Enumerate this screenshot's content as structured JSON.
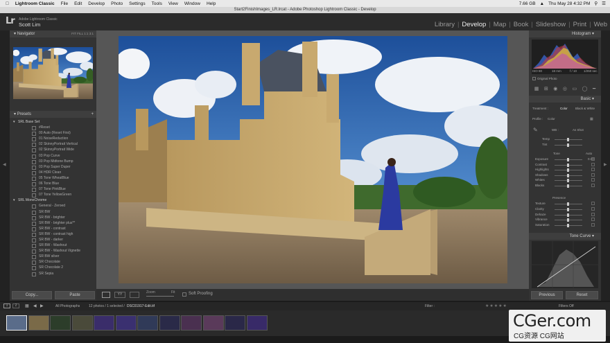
{
  "menubar": {
    "items": [
      "Lightroom Classic",
      "File",
      "Edit",
      "Develop",
      "Photo",
      "Settings",
      "Tools",
      "View",
      "Window",
      "Help"
    ],
    "battery": "7.66 GB",
    "datetime": "Thu May 28  4:32 PM"
  },
  "window": {
    "title": "Start2FinishImages_LR.lrcat - Adobe Photoshop Lightroom Classic - Develop"
  },
  "identity": {
    "logo": "Lr",
    "catalog": "Adobe Lightroom Classic",
    "user": "Scott Lim"
  },
  "modules": [
    "Library",
    "Develop",
    "Map",
    "Book",
    "Slideshow",
    "Print",
    "Web"
  ],
  "navigator": {
    "title": "Navigator",
    "zoom": [
      "FIT",
      "FILL",
      "1:1",
      "3:1"
    ]
  },
  "presets": {
    "title": "Presets",
    "rows": [
      {
        "type": "grp",
        "label": "SRL Base Set"
      },
      {
        "type": "it",
        "label": "#Reset"
      },
      {
        "type": "it",
        "label": "00 Auto (Reset First)"
      },
      {
        "type": "it",
        "label": "01 NoiseReduction"
      },
      {
        "type": "it",
        "label": "02 SkinnyPortrait Vertical"
      },
      {
        "type": "it",
        "label": "02 SkinnyPortrait Wide"
      },
      {
        "type": "it",
        "label": "03 Pop Curve"
      },
      {
        "type": "it",
        "label": "03 Pop Midtone Bump"
      },
      {
        "type": "it",
        "label": "03 Pop Super Duper"
      },
      {
        "type": "it",
        "label": "04 HDR Clean"
      },
      {
        "type": "it",
        "label": "05 Tone WheatBlue"
      },
      {
        "type": "it",
        "label": "06 Tone Blue"
      },
      {
        "type": "it",
        "label": "07 Tone PinkBlue"
      },
      {
        "type": "it",
        "label": "07 Tone YellowGreen"
      },
      {
        "type": "grp",
        "label": "SRL MonoChrome"
      },
      {
        "type": "it",
        "label": "General - Zeroed"
      },
      {
        "type": "it",
        "label": "SR BW"
      },
      {
        "type": "it",
        "label": "SR BW - brighter"
      },
      {
        "type": "it",
        "label": "SR BW - brighter plus**"
      },
      {
        "type": "it",
        "label": "SR BW - contrast"
      },
      {
        "type": "it",
        "label": "SR BW - contrast high"
      },
      {
        "type": "it",
        "label": "SR BW - darker"
      },
      {
        "type": "it",
        "label": "SR BW - Washout"
      },
      {
        "type": "it",
        "label": "SR BW - Washout Vignette"
      },
      {
        "type": "it",
        "label": "SR BW silver"
      },
      {
        "type": "it",
        "label": "SR Chocolate"
      },
      {
        "type": "it",
        "label": "SR Chocolate 2"
      },
      {
        "type": "it",
        "label": "SR Sepia"
      }
    ]
  },
  "leftbuttons": {
    "copy": "Copy...",
    "paste": "Paste"
  },
  "toolbar": {
    "zoom_label": "Zoom",
    "zoom_value": "Fit",
    "soft_proofing": "Soft Proofing"
  },
  "right": {
    "histogram_title": "Histogram",
    "exif": [
      "ISO 80",
      "18 mm",
      "f / 10",
      "1/250 sec"
    ],
    "original_photo": "Original Photo",
    "basic_title": "Basic",
    "treatment": "Treatment :",
    "color": "Color",
    "bw": "Black & White",
    "profile": "Profile :",
    "profile_val": "Color",
    "wb": "WB :",
    "wb_val": "As Shot",
    "temp": "Temp",
    "tint": "Tint",
    "tone": "Tone",
    "auto": "Auto",
    "sliders": [
      "Exposure",
      "Contrast",
      "Highlights",
      "Shadows",
      "Whites",
      "Blacks"
    ],
    "exposure_val": "0.00",
    "presence": "Presence",
    "presence_sliders": [
      "Texture",
      "Clarity",
      "Dehaze",
      "Vibrance",
      "Saturation"
    ],
    "tonecurve_title": "Tone Curve",
    "previous": "Previous",
    "reset": "Reset"
  },
  "filmstrip": {
    "pages": [
      "1",
      "2"
    ],
    "source": "All Photographs",
    "count": "12 photos / 1 selected /",
    "filename": "DSC01917-Edit.tif",
    "filter_label": "Filter :",
    "filter_value": "Filters Off"
  },
  "watermark": {
    "line1": "CGer.com",
    "line2": "CG资源 CG网站"
  }
}
